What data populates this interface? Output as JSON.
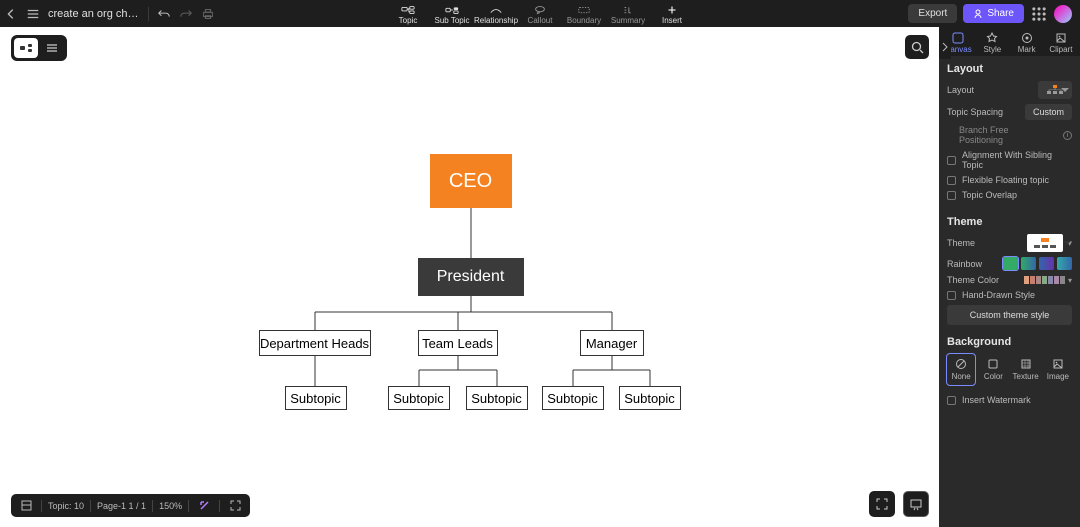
{
  "doc_title": "create an org chart for a c...",
  "toolbar": {
    "topic": "Topic",
    "subtopic": "Sub Topic",
    "relationship": "Relationship",
    "callout": "Callout",
    "boundary": "Boundary",
    "summary": "Summary",
    "insert": "Insert",
    "export": "Export",
    "share": "Share"
  },
  "side_tabs": {
    "canvas": "Canvas",
    "style": "Style",
    "mark": "Mark",
    "clipart": "Clipart"
  },
  "panel": {
    "layout": {
      "title": "Layout",
      "layout": "Layout",
      "spacing": "Topic Spacing",
      "custom": "Custom",
      "bfp": "Branch Free Positioning",
      "align": "Alignment With Sibling Topic",
      "flex": "Flexible Floating topic",
      "overlap": "Topic Overlap"
    },
    "theme": {
      "title": "Theme",
      "theme": "Theme",
      "rainbow": "Rainbow",
      "color": "Theme Color",
      "hand": "Hand-Drawn Style",
      "custom_btn": "Custom theme style"
    },
    "bg": {
      "title": "Background",
      "none": "None",
      "color": "Color",
      "texture": "Texture",
      "image": "Image",
      "wm": "Insert Watermark"
    }
  },
  "chart": {
    "ceo": "CEO",
    "president": "President",
    "depts": [
      "Department Heads",
      "Team Leads",
      "Manager"
    ],
    "subs": [
      "Subtopic",
      "Subtopic",
      "Subtopic",
      "Subtopic",
      "Subtopic"
    ]
  },
  "bottom": {
    "topic": "Topic: 10",
    "page": "Page-1  1 / 1",
    "zoom": "150%"
  },
  "theme_colors": [
    "#e09f7d",
    "#c97f6e",
    "#a88",
    "#8a8",
    "#88a",
    "#a8a",
    "#888"
  ],
  "chart_data": {
    "type": "org_tree",
    "root": {
      "label": "CEO",
      "children": [
        {
          "label": "President",
          "children": [
            {
              "label": "Department Heads",
              "children": [
                {
                  "label": "Subtopic"
                }
              ]
            },
            {
              "label": "Team Leads",
              "children": [
                {
                  "label": "Subtopic"
                },
                {
                  "label": "Subtopic"
                }
              ]
            },
            {
              "label": "Manager",
              "children": [
                {
                  "label": "Subtopic"
                },
                {
                  "label": "Subtopic"
                }
              ]
            }
          ]
        }
      ]
    }
  }
}
